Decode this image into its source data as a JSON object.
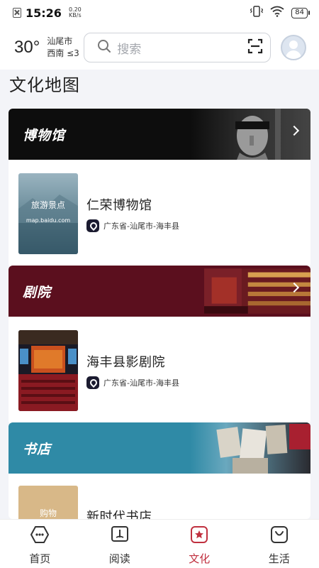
{
  "status_bar": {
    "time": "15:26",
    "net_speed_value": "0.20",
    "net_speed_unit": "KB/s",
    "battery": "84"
  },
  "header": {
    "temperature": "30°",
    "city": "汕尾市",
    "wind": "西南 ≤3",
    "search_placeholder": "搜索"
  },
  "page_title": "文化地图",
  "sections": [
    {
      "title": "博物馆",
      "item": {
        "name": "仁荣博物馆",
        "location": "广东省-汕尾市-海丰县",
        "thumb_title": "旅游景点",
        "thumb_sub": "map.baidu.com"
      }
    },
    {
      "title": "剧院",
      "item": {
        "name": "海丰县影剧院",
        "location": "广东省-汕尾市-海丰县"
      }
    },
    {
      "title": "书店",
      "item": {
        "name": "新时代书店",
        "thumb_title": "购物"
      }
    }
  ],
  "bottom_nav": [
    {
      "label": "首页",
      "icon": "home-icon",
      "active": false
    },
    {
      "label": "阅读",
      "icon": "book-icon",
      "active": false
    },
    {
      "label": "文化",
      "icon": "culture-star-icon",
      "active": true
    },
    {
      "label": "生活",
      "icon": "life-bag-icon",
      "active": false
    }
  ],
  "colors": {
    "accent": "#c0303f",
    "museum_banner": "#0d0d0d",
    "theater_banner": "#5b0f1e",
    "bookstore_banner": "#2f8aa6"
  }
}
